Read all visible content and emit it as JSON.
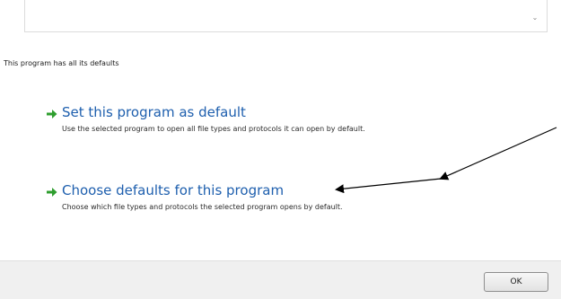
{
  "program_list": {
    "scroll_down_glyph": "⌄"
  },
  "status_text": "This program has all its defaults",
  "options": [
    {
      "title": "Set this program as default",
      "description": "Use the selected program to open all file types and protocols it can open by default.",
      "icon": "green-arrow-icon"
    },
    {
      "title": "Choose defaults for this program",
      "description": "Choose which file types and protocols the selected program opens by default.",
      "icon": "green-arrow-icon"
    }
  ],
  "footer": {
    "ok_label": "OK"
  },
  "colors": {
    "link": "#1e5fae",
    "arrow_icon": "#2e9e2e",
    "footer_bg": "#f0f0f0"
  }
}
